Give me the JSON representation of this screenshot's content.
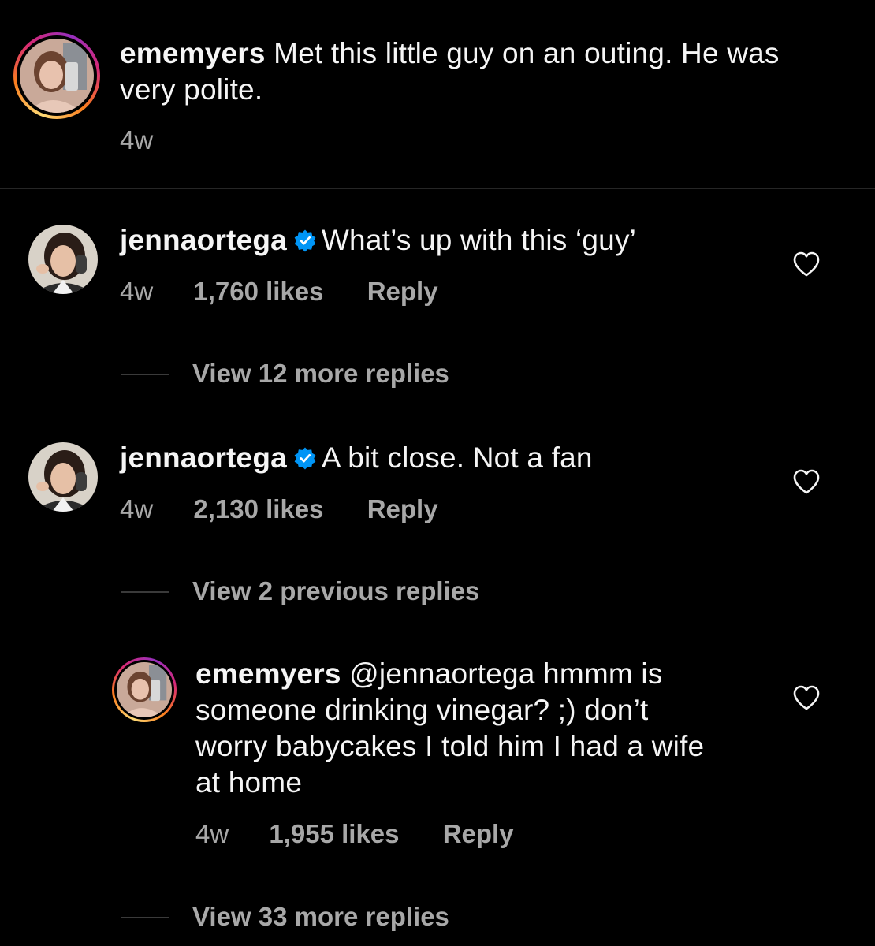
{
  "caption": {
    "username": "ememyers",
    "text": " Met this little guy on an outing. He was very polite.",
    "time": "4w"
  },
  "comments": [
    {
      "username": "jennaortega",
      "verified": true,
      "text": "What’s up with this ‘guy’",
      "time": "4w",
      "likes": "1,760 likes",
      "reply_label": "Reply",
      "view_replies": "View 12 more replies"
    },
    {
      "username": "jennaortega",
      "verified": true,
      "text": "A bit close. Not a fan",
      "time": "4w",
      "likes": "2,130 likes",
      "reply_label": "Reply",
      "view_replies": "View 2 previous replies"
    }
  ],
  "reply": {
    "username": "ememyers",
    "text": " @jennaortega hmmm is someone drinking vinegar? ;) don’t worry babycakes I told him I had a wife at home",
    "time": "4w",
    "likes": "1,955 likes",
    "reply_label": "Reply",
    "view_replies": "View 33 more replies"
  },
  "icons": {
    "like": "heart-outline-icon",
    "verified": "verified-badge-icon"
  },
  "colors": {
    "background": "#000000",
    "text": "#f5f5f5",
    "secondary": "#a8a8a8",
    "verified": "#0095f6"
  }
}
